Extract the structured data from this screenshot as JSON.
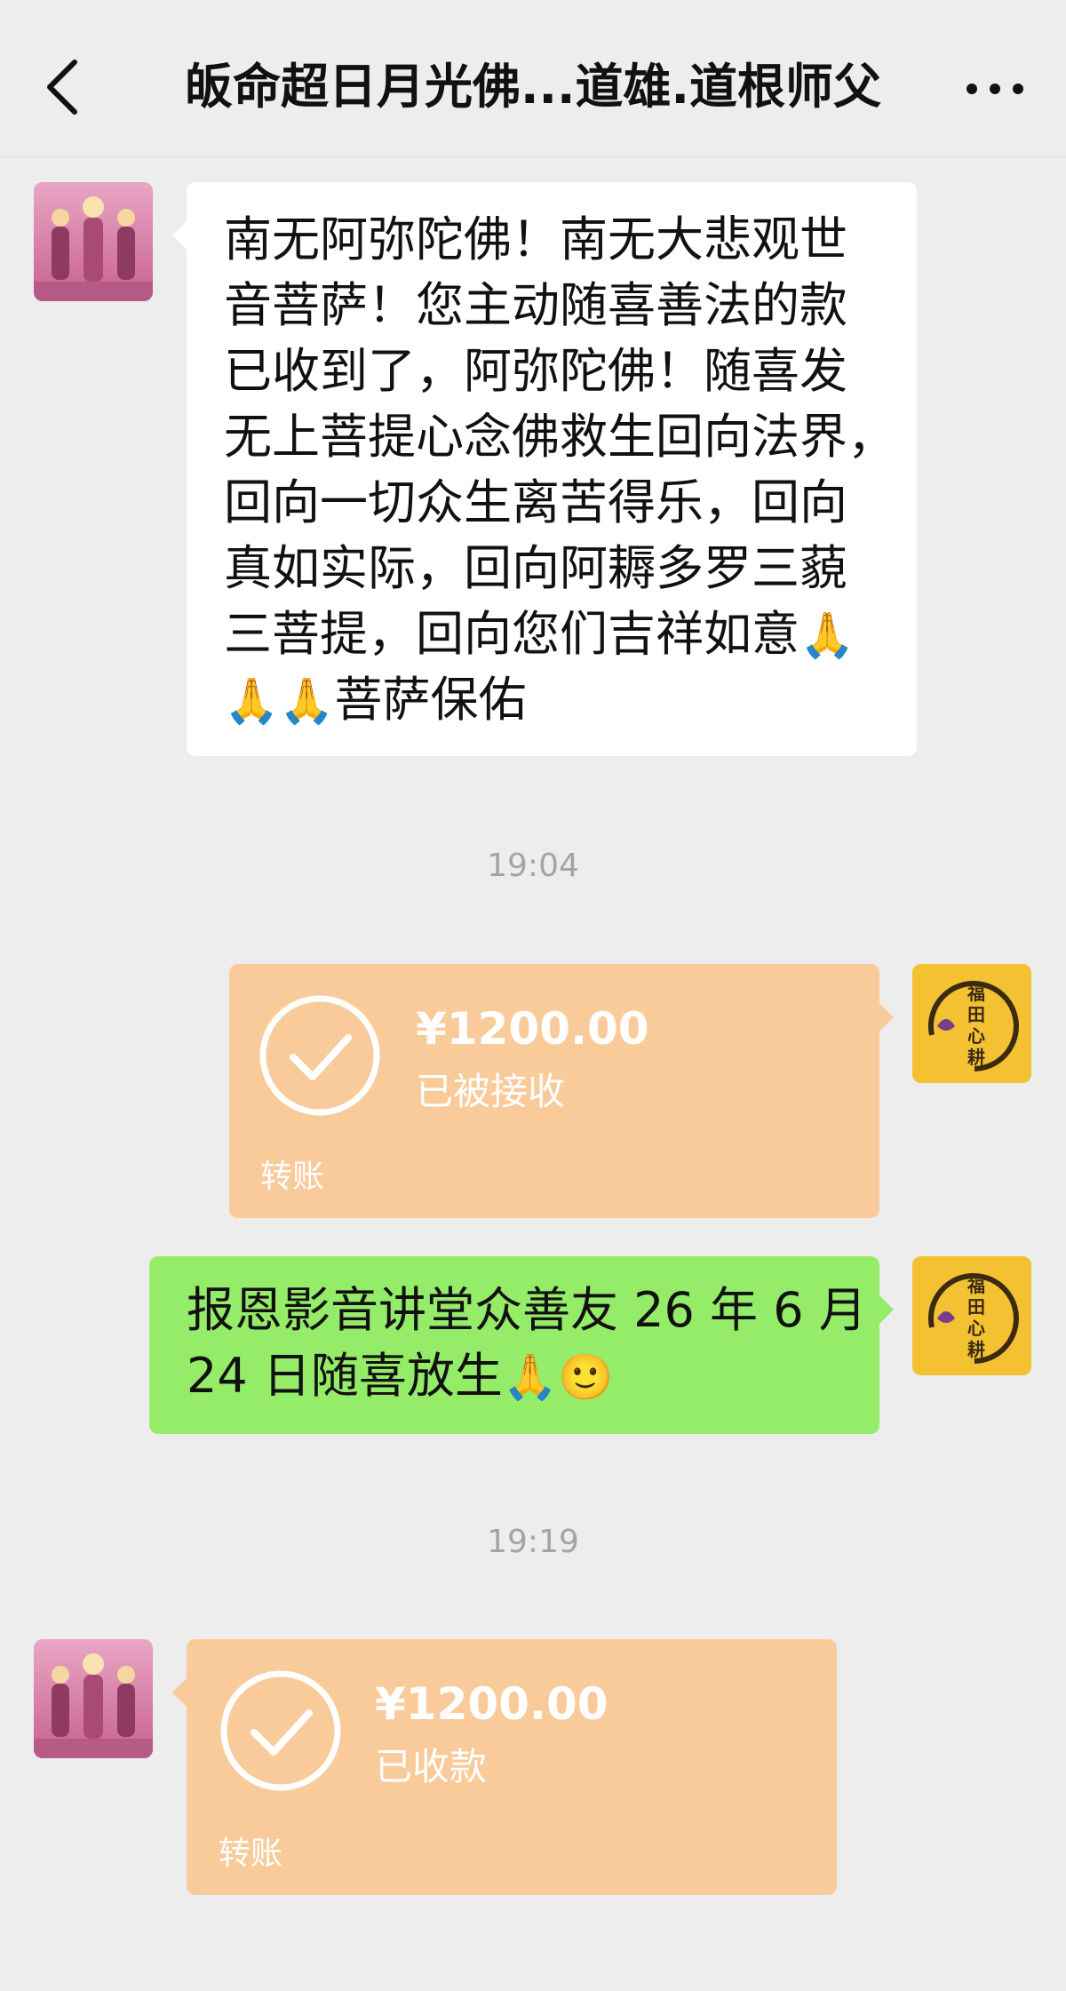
{
  "header": {
    "title": "皈命超日月光佛...道雄.道根师父"
  },
  "messages": {
    "m1": {
      "sender": "contact",
      "text_line1": "南无阿弥陀佛！南无大悲观世",
      "text_line2": "音菩萨！您主动随喜善法的款",
      "text_line3": "已收到了，阿弥陀佛！随喜发",
      "text_line4": "无上菩提心念佛救生回向法界，",
      "text_line5": "回向一切众生离苦得乐，回向",
      "text_line6": "真如实际，回向阿耨多罗三藐",
      "text_line7": "三菩提，回向您们吉祥如意",
      "text_line8": "菩萨保佑"
    },
    "time1": "19:04",
    "m2": {
      "sender": "me",
      "amount": "¥1200.00",
      "status": "已被接收",
      "label": "转账"
    },
    "m3": {
      "sender": "me",
      "text_line1": "报恩影音讲堂众善友 26 年 6 月",
      "text_line2": "24 日随喜放生"
    },
    "time2": "19:19",
    "m4": {
      "sender": "contact",
      "amount": "¥1200.00",
      "status": "已收款",
      "label": "转账"
    }
  },
  "my_avatar": {
    "text": "福田心耕"
  },
  "colors": {
    "background": "#ededed",
    "bubble_white": "#ffffff",
    "bubble_green": "#95ec69",
    "transfer_orange": "#f9cb9a"
  },
  "icons": [
    "back-icon",
    "more-icon",
    "check-icon",
    "pray-hands-icon",
    "smile-icon"
  ]
}
